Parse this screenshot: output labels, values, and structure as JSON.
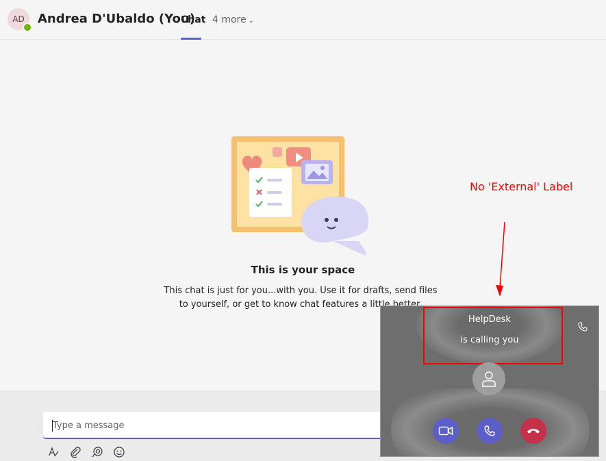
{
  "header": {
    "avatar_initials": "AD",
    "title": "Andrea D'Ubaldo (You)",
    "tabs": [
      {
        "label": "Chat",
        "active": true
      },
      {
        "label": "4 more",
        "dropdown": true
      }
    ]
  },
  "empty_state": {
    "title": "This is your space",
    "description": "This chat is just for you...with you. Use it for drafts, send files to yourself, or get to know chat features a little better."
  },
  "compose": {
    "placeholder": "Type a message",
    "tools": [
      "format-icon",
      "attach-icon",
      "loop-icon",
      "emoji-icon"
    ]
  },
  "annotation": {
    "text": "No 'External' Label",
    "color": "#ff0000"
  },
  "call_toast": {
    "caller": "HelpDesk",
    "status": "is calling you",
    "buttons": [
      "accept-video",
      "accept-audio",
      "decline"
    ]
  },
  "colors": {
    "accent": "#5b5fc7",
    "decline": "#c4314b",
    "presence": "#6bb700"
  }
}
